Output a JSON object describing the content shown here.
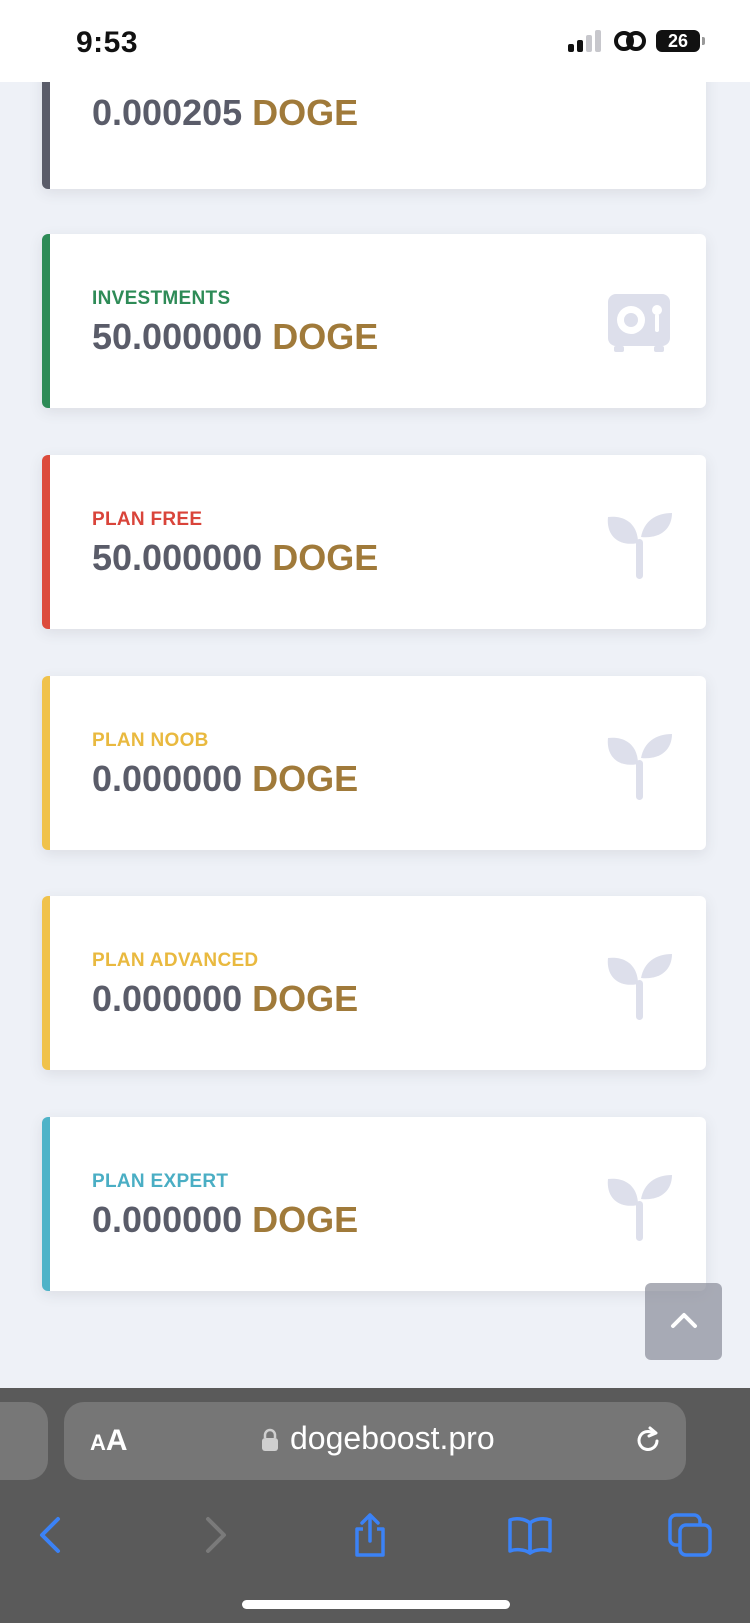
{
  "status_bar": {
    "time": "9:53",
    "battery": "26"
  },
  "cards": [
    {
      "label": "",
      "amount": "0.000205",
      "currency": "DOGE",
      "accent": "#5a5c69",
      "label_color": "#5a5c69",
      "icon": ""
    },
    {
      "label": "INVESTMENTS",
      "amount": "50.000000",
      "currency": "DOGE",
      "accent": "#2e8b57",
      "label_color": "#2e8b57",
      "icon": "vault-icon"
    },
    {
      "label": "PLAN FREE",
      "amount": "50.000000",
      "currency": "DOGE",
      "accent": "#dc4b3c",
      "label_color": "#d9443a",
      "icon": "seedling-icon"
    },
    {
      "label": "PLAN NOOB",
      "amount": "0.000000",
      "currency": "DOGE",
      "accent": "#f0c24b",
      "label_color": "#e9b93f",
      "icon": "seedling-icon"
    },
    {
      "label": "PLAN ADVANCED",
      "amount": "0.000000",
      "currency": "DOGE",
      "accent": "#f0c24b",
      "label_color": "#e9b93f",
      "icon": "seedling-icon"
    },
    {
      "label": "PLAN EXPERT",
      "amount": "0.000000",
      "currency": "DOGE",
      "accent": "#4fb3c8",
      "label_color": "#4aaec4",
      "icon": "seedling-icon"
    }
  ],
  "browser": {
    "aa_big": "A",
    "aa_small": "A",
    "url": "dogeboost.pro"
  },
  "icons": {
    "scroll_top": "chevron-up-icon",
    "back": "chevron-left-icon",
    "forward": "chevron-right-icon",
    "share": "share-icon",
    "bookmarks": "book-icon",
    "tabs": "tabs-icon"
  },
  "colors": {
    "value_text": "#5a5c69",
    "currency_text": "#a07a3a",
    "icon_muted": "#dddfeb",
    "browser_accent": "#3b82f6"
  }
}
